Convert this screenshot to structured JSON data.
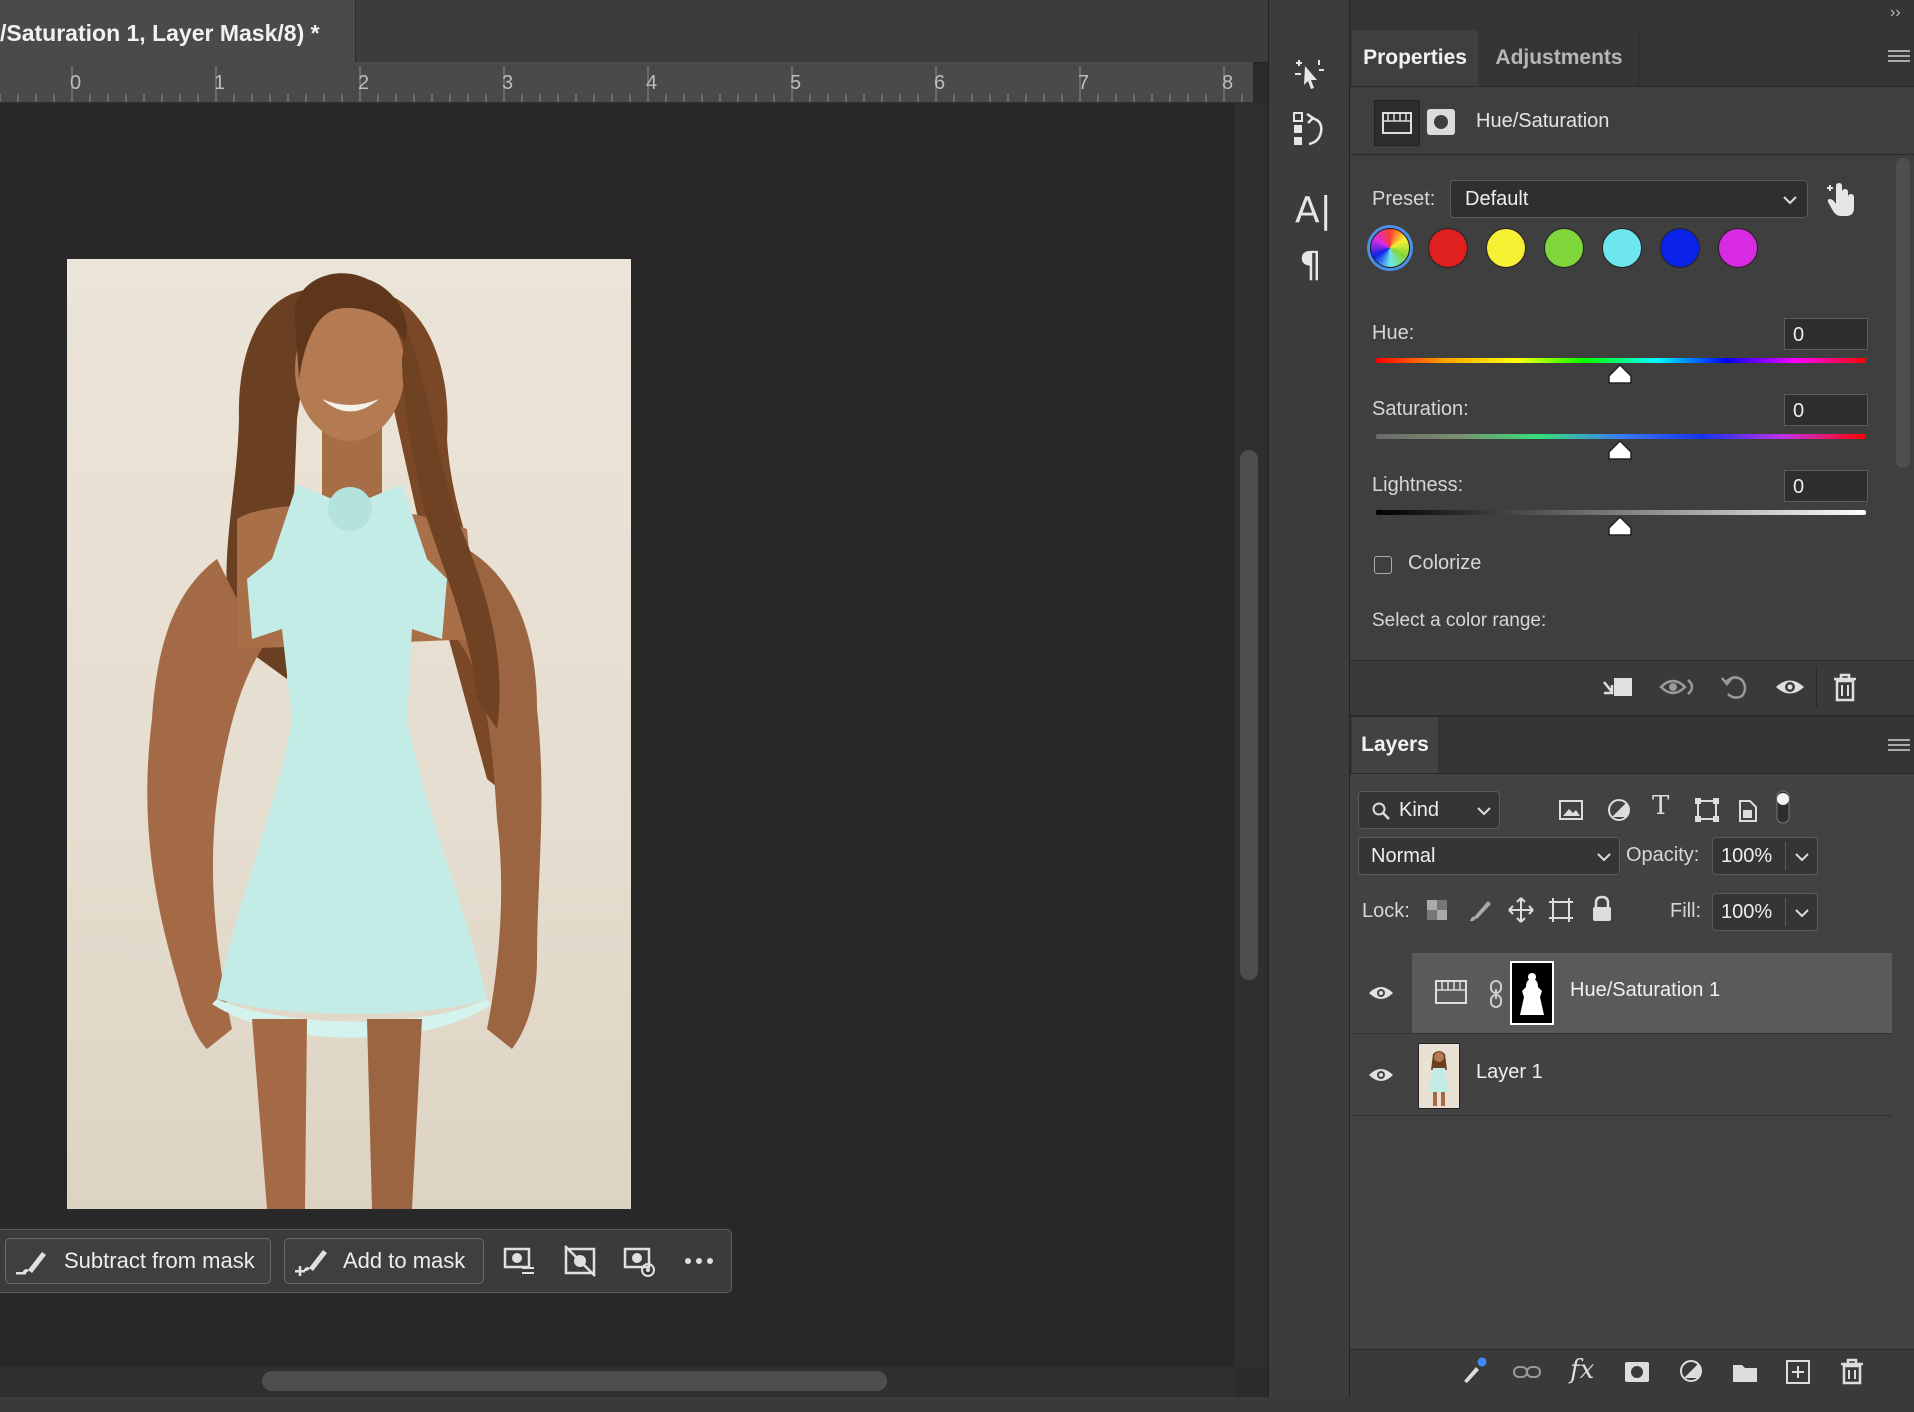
{
  "document": {
    "tab_title": "/Saturation 1, Layer Mask/8) *",
    "ruler_numbers": [
      "0",
      "1",
      "2",
      "3",
      "4",
      "5",
      "6",
      "7",
      "8"
    ]
  },
  "contextual_taskbar": {
    "subtract_label": "Subtract from mask",
    "add_label": "Add to mask"
  },
  "collapse_glyphs": {
    "left": "‹‹",
    "right": "››"
  },
  "properties": {
    "tabs": [
      "Properties",
      "Adjustments"
    ],
    "adjustment_name": "Hue/Saturation",
    "preset_label": "Preset:",
    "preset_value": "Default",
    "swatch_colors": [
      "#ff3b30",
      "#e02020",
      "#f5f032",
      "#7ed63a",
      "#6ee6f0",
      "#0a22e8",
      "#d82ae0"
    ],
    "hue_label": "Hue:",
    "hue_value": "0",
    "saturation_label": "Saturation:",
    "saturation_value": "0",
    "lightness_label": "Lightness:",
    "lightness_value": "0",
    "colorize_label": "Colorize",
    "colorize_checked": false,
    "select_range_label": "Select a color range:"
  },
  "layers": {
    "tab": "Layers",
    "filter_value": "Kind",
    "blend_mode": "Normal",
    "opacity_label": "Opacity:",
    "opacity_value": "100%",
    "lock_label": "Lock:",
    "fill_label": "Fill:",
    "fill_value": "100%",
    "items": [
      {
        "name": "Hue/Saturation 1",
        "visible": true,
        "selected": true
      },
      {
        "name": "Layer 1",
        "visible": true,
        "selected": false
      }
    ]
  }
}
